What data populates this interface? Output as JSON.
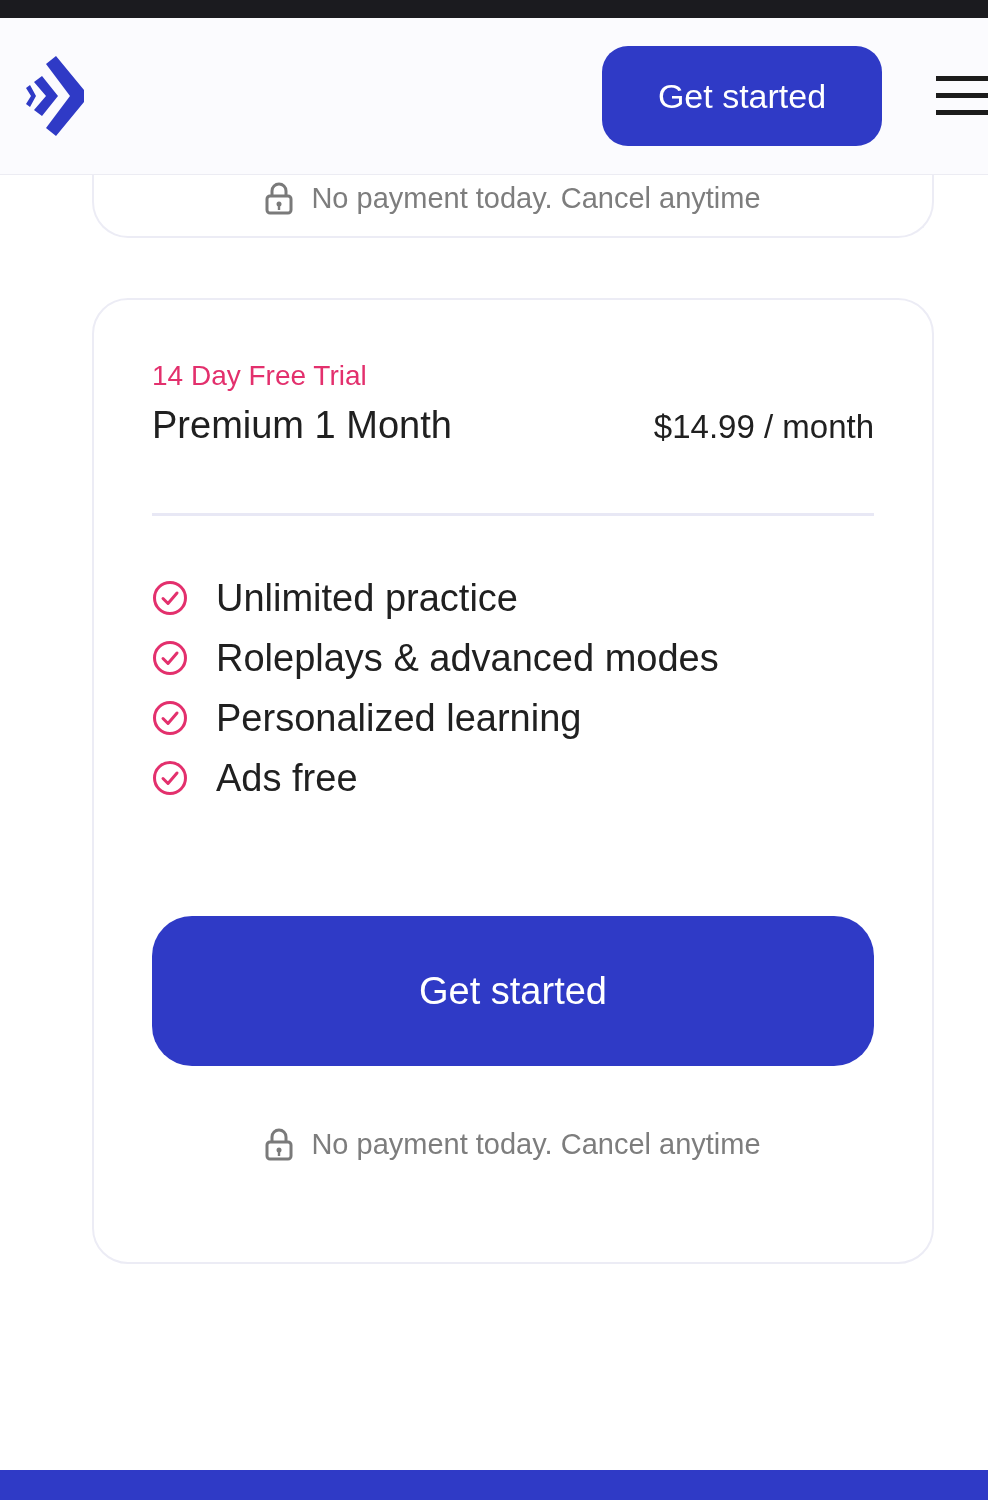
{
  "header": {
    "button": "Get started"
  },
  "previous_plan": {
    "note": "No payment today. Cancel anytime"
  },
  "plan": {
    "badge": "14 Day Free Trial",
    "name": "Premium 1 Month",
    "price": "$14.99 / month",
    "features": [
      {
        "text": "Unlimited practice"
      },
      {
        "text": "Roleplays & advanced modes"
      },
      {
        "text": "Personalized learning"
      },
      {
        "text": "Ads free"
      }
    ],
    "button": "Get started",
    "note": "No payment today. Cancel anytime"
  }
}
